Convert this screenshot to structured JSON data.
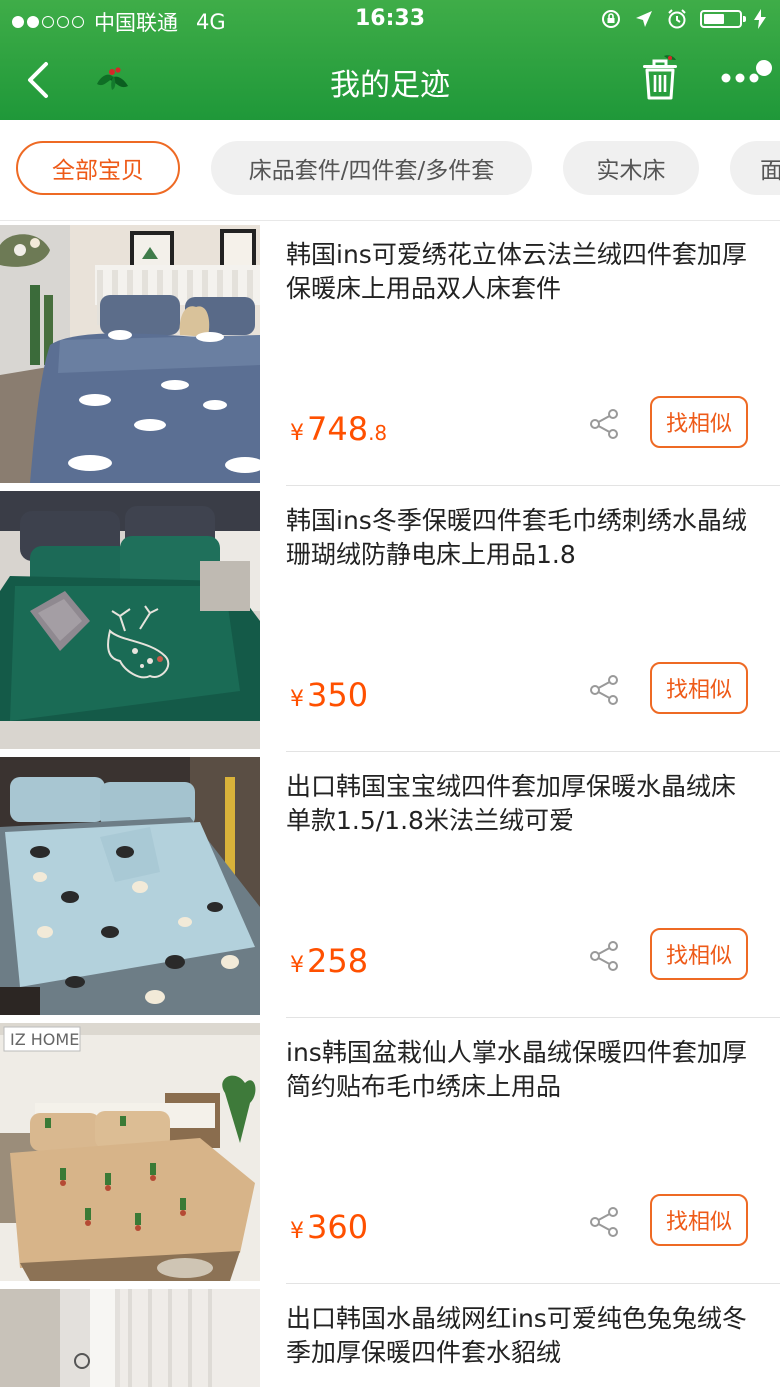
{
  "status_bar": {
    "carrier": "中国联通",
    "network": "4G",
    "time": "16:33",
    "signal_strength": 2,
    "battery_level": 0.6
  },
  "header": {
    "title": "我的足迹",
    "colors": {
      "bar": "#2a9e3d",
      "accent": "#ee5a18",
      "price": "#ff5000"
    }
  },
  "tabs": [
    {
      "label": "全部宝贝",
      "active": true
    },
    {
      "label": "床品套件/四件套/多件套",
      "active": false
    },
    {
      "label": "实木床",
      "active": false
    },
    {
      "label": "面",
      "active": false
    }
  ],
  "products": [
    {
      "title": "韩国ins可爱绣花立体云法兰绒四件套加厚保暖床上用品双人床套件",
      "currency": "¥",
      "price_int": "748",
      "price_dec": ".8",
      "similar_label": "找相似",
      "image_theme": "blue-clouds"
    },
    {
      "title": "韩国ins冬季保暖四件套毛巾绣刺绣水晶绒珊瑚绒防静电床上用品1.8",
      "currency": "¥",
      "price_int": "350",
      "price_dec": "",
      "similar_label": "找相似",
      "image_theme": "green-deer"
    },
    {
      "title": "出口韩国宝宝绒四件套加厚保暖水晶绒床单款1.5/1.8米法兰绒可爱",
      "currency": "¥",
      "price_int": "258",
      "price_dec": "",
      "similar_label": "找相似",
      "image_theme": "light-blue-dogs"
    },
    {
      "title": "ins韩国盆栽仙人掌水晶绒保暖四件套加厚简约贴布毛巾绣床上用品",
      "currency": "¥",
      "price_int": "360",
      "price_dec": "",
      "similar_label": "找相似",
      "image_theme": "beige-cactus",
      "watermark": "IZ HOME"
    },
    {
      "title": "出口韩国水晶绒网红ins可爱纯色兔兔绒冬季加厚保暖四件套水貂绒",
      "currency": "",
      "price_int": "",
      "price_dec": "",
      "similar_label": "",
      "image_theme": "curtain-room"
    }
  ]
}
